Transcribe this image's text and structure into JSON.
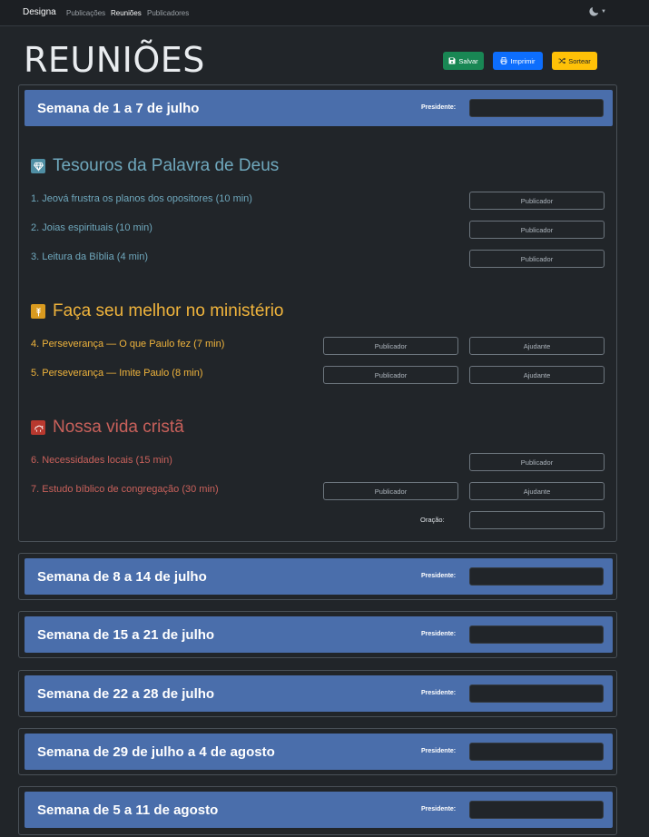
{
  "navbar": {
    "brand": "Designa",
    "links": [
      "Publicações",
      "Reuniões",
      "Publicadores"
    ],
    "active_index": 1,
    "theme_icon": "moon-icon"
  },
  "page": {
    "title": "REUNIÕES"
  },
  "toolbar": {
    "save_label": "Salvar",
    "print_label": "Imprimir",
    "draw_label": "Sortear",
    "save_color": "#198754",
    "print_color": "#0d6efd",
    "draw_color": "#ffc107"
  },
  "colors": {
    "week_header": "#4a6eab",
    "treasures": "#6fa8bd",
    "ministry": "#f0b43c",
    "christian_life": "#c9615b",
    "background": "#212529"
  },
  "president_label": "Presidente:",
  "first_week": {
    "title": "Semana de 1 a 7 de julho",
    "sections": {
      "treasures": {
        "title": "Tesouros da Palavra de Deus",
        "icon": "diamond-icon",
        "parts": [
          {
            "label": "1. Jeová frustra os planos dos opositores (10 min)",
            "slot": "Publicador"
          },
          {
            "label": "2. Joias espirituais (10 min)",
            "slot": "Publicador"
          },
          {
            "label": "3. Leitura da Bíblia (4 min)",
            "slot": "Publicador"
          }
        ]
      },
      "ministry": {
        "title": "Faça seu melhor no ministério",
        "icon": "wheat-icon",
        "parts": [
          {
            "label": "4. Perseverança — O que Paulo fez (7 min)",
            "slot": "Publicador",
            "assistant": "Ajudante"
          },
          {
            "label": "5. Perseverança — Imite Paulo (8 min)",
            "slot": "Publicador",
            "assistant": "Ajudante"
          }
        ]
      },
      "christian_life": {
        "title": "Nossa vida cristã",
        "icon": "sheep-icon",
        "parts": [
          {
            "label": "6. Necessidades locais (15 min)",
            "slot": "Publicador"
          },
          {
            "label": "7. Estudo bíblico de congregação (30 min)",
            "slot": "Publicador",
            "assistant": "Ajudante"
          }
        ]
      }
    },
    "prayer_label": "Oração:"
  },
  "other_weeks": [
    {
      "title": "Semana de 8 a 14 de julho"
    },
    {
      "title": "Semana de 15 a 21 de julho"
    },
    {
      "title": "Semana de 22 a 28 de julho"
    },
    {
      "title": "Semana de 29 de julho a 4 de agosto"
    },
    {
      "title": "Semana de 5 a 11 de agosto"
    }
  ]
}
